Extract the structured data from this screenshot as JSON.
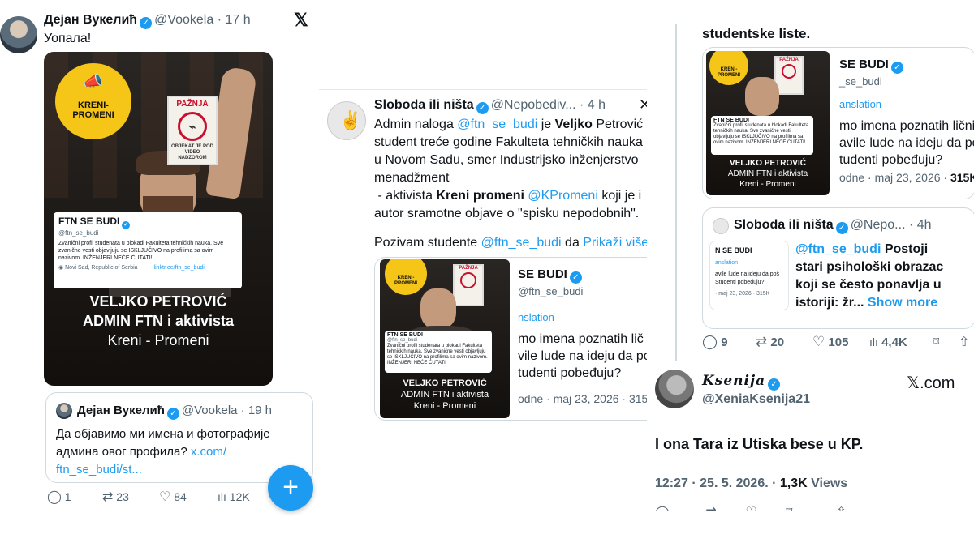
{
  "left_tweet": {
    "name": "Дејан Вукелић",
    "handle": "@Vookela",
    "time": "· 17 h",
    "text": "Уопала!",
    "x_logo": "𝕏"
  },
  "poster": {
    "kreni_line1": "KRENI-",
    "kreni_line2": "PROMENI",
    "sign_title": "PAŽNJA",
    "sign_text": "OBJEKAT JE POD VIDEO NADZOROM",
    "profile_name": "FTN SE BUDI",
    "profile_handle": "@ftn_se_budi",
    "profile_bio": "Zvanični profil studenata u blokadi Fakulteta tehničkih nauka. Sve zvanične vesti objavljuju se ISKLJUČIVO na profilima sa ovim nazivom. INŽENJERI NEĆE ĆUTATI!",
    "profile_location": "Novi Sad, Republic of Serbia",
    "profile_link": "linktr.ee/ftn_se_budi",
    "caption_line1": "VELJKO PETROVIĆ",
    "caption_line2": "ADMIN FTN i aktivista",
    "caption_line3": "Kreni - Promeni"
  },
  "quoted_tweet": {
    "name": "Дејан Вукелић",
    "handle": "@Vookela",
    "time": "· 19 h",
    "text": "Да објавимо ми имена и фотографије админа овог профила?",
    "link": "x.com/ ftn_se_budi/st..."
  },
  "left_actions": {
    "replies": "1",
    "reposts": "23",
    "likes": "84",
    "views": "12K"
  },
  "fab_symbol": "+",
  "middle_tweet": {
    "name": "Sloboda ili ništa",
    "handle": "@Nepobediv...",
    "time": "· 4 h",
    "line1_a": "Admin naloga ",
    "line1_mention": "@ftn_se_budi",
    "line1_b": " je ",
    "line1_bold": "Veljko",
    "line1_c": " Petrović",
    "line2": "student treće godine Fakulteta tehničkih nauka",
    "line3": "u Novom Sadu, smer Industrijsko inženjerstvo",
    "line4": "menadžment",
    "line5_a": " - aktivista ",
    "line5_bold": "Kreni promeni",
    "line5_mention": " @KPromeni",
    "line5_b": " koji je i",
    "line6": "autor sramotne objave o \"spisku nepodobnih\".",
    "line7_a": "Pozivam studente ",
    "line7_mention": "@ftn_se_budi",
    "line7_b": " da ",
    "line7_more": "Prikaži više"
  },
  "embedded_card": {
    "name": "SE BUDI",
    "handle": "@ftn_se_budi",
    "translation": "nslation",
    "text1": "mo imena poznatih lič",
    "text2": "vile lude na ideju da po",
    "text3": "tudenti pobeđuju?",
    "meta": "odne · maj 23, 2026 · 315"
  },
  "right_top": {
    "text": "studentske liste.",
    "card_name": "SE BUDI",
    "card_handle": "_se_budi",
    "translation": "anslation",
    "text1": "mo imena poznatih lični",
    "text2": "avile lude na ideju da poš",
    "text3": "tudenti pobeđuju?",
    "meta": "odne · maj 23, 2026 · ",
    "meta_bold": "315K"
  },
  "right_quote": {
    "name": "Sloboda ili ništa",
    "handle": "@Nepo...",
    "time": "· 4h",
    "mention": "@ftn_se_budi",
    "text1": " Postoji",
    "text2": "stari psihološki obrazac",
    "text3": "koji se često ponavlja u",
    "text4": "istoriji: žr...",
    "more": "Show more",
    "mini_name": "N SE BUDI",
    "mini_translation": "anslation",
    "mini_text1": "avile lude na ideju da poš",
    "mini_text2": "Studenti pobeđuju?",
    "mini_meta": "· maj 23, 2026 · 315K"
  },
  "right_actions": {
    "replies": "9",
    "reposts": "20",
    "likes": "105",
    "views": "4,4K"
  },
  "right_bottom": {
    "name": "Ksenija",
    "handle": "@XeniaKsenija21",
    "x_logo": "𝕏.com",
    "text": "I ona Tara iz Utiska bese u KP.",
    "time": "12:27 · 25. 5. 2026. · ",
    "views_count": "1,3K",
    "views_label": " Views"
  },
  "colors": {
    "accent": "#1d9bf0",
    "text": "#0f1419",
    "secondary": "#536471",
    "kreni_yellow": "#f5c518"
  }
}
